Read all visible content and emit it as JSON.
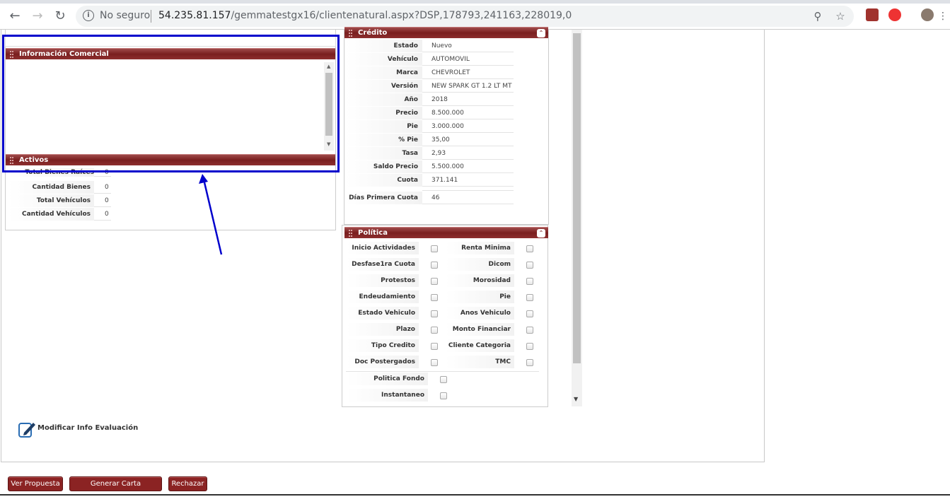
{
  "browser": {
    "security_label": "No seguro",
    "url_host": "54.235.81.157",
    "url_path": "/gemmatestgx16/clientenatural.aspx?DSP,178793,241163,228019,0"
  },
  "info_comercial": {
    "title": "Información Comercial"
  },
  "activos": {
    "title": "Activos",
    "rows": [
      {
        "label": "Total Bienes Raíces",
        "value": "0"
      },
      {
        "label": "Cantidad Bienes Raices",
        "value": "0"
      },
      {
        "label": "Total Vehículos",
        "value": "0"
      },
      {
        "label": "Cantidad Vehículos",
        "value": "0"
      }
    ]
  },
  "credito": {
    "title": "Crédito",
    "rows": [
      {
        "label": "Estado",
        "value": "Nuevo"
      },
      {
        "label": "Vehículo",
        "value": "AUTOMOVIL"
      },
      {
        "label": "Marca",
        "value": "CHEVROLET"
      },
      {
        "label": "Versión",
        "value": "NEW SPARK GT 1.2 LT MT"
      },
      {
        "label": "Año",
        "value": "2018"
      },
      {
        "label": "Precio",
        "value": "8.500.000"
      },
      {
        "label": "Pie",
        "value": "3.000.000"
      },
      {
        "label": "% Pie",
        "value": "35,00"
      },
      {
        "label": "Tasa",
        "value": "2,93"
      },
      {
        "label": "Saldo Precio",
        "value": "5.500.000"
      },
      {
        "label": "Cuota",
        "value": "371.141"
      },
      {
        "label": "Días Primera Cuota",
        "value": "46"
      }
    ]
  },
  "politica": {
    "title": "Política",
    "left": [
      "Inicio Actividades",
      "Desfase1ra Cuota",
      "Protestos",
      "Endeudamiento",
      "Estado Vehiculo",
      "Plazo",
      "Tipo Credito",
      "Doc Postergados"
    ],
    "right": [
      "Renta Minima",
      "Dicom",
      "Morosidad",
      "Pie",
      "Anos Vehiculo",
      "Monto Financiar",
      "Cliente Categoria",
      "TMC"
    ],
    "extra": [
      "Politica Fondo",
      "Instantaneo"
    ]
  },
  "modify_link": {
    "label": "Modificar Info Evaluación"
  },
  "buttons": {
    "ver_propuesta": "Ver Propuesta",
    "generar_carta": "Generar Carta Aprobación",
    "rechazar": "Rechazar"
  },
  "colors": {
    "panel_header": "#8b2323",
    "annotation": "#0000cc"
  }
}
